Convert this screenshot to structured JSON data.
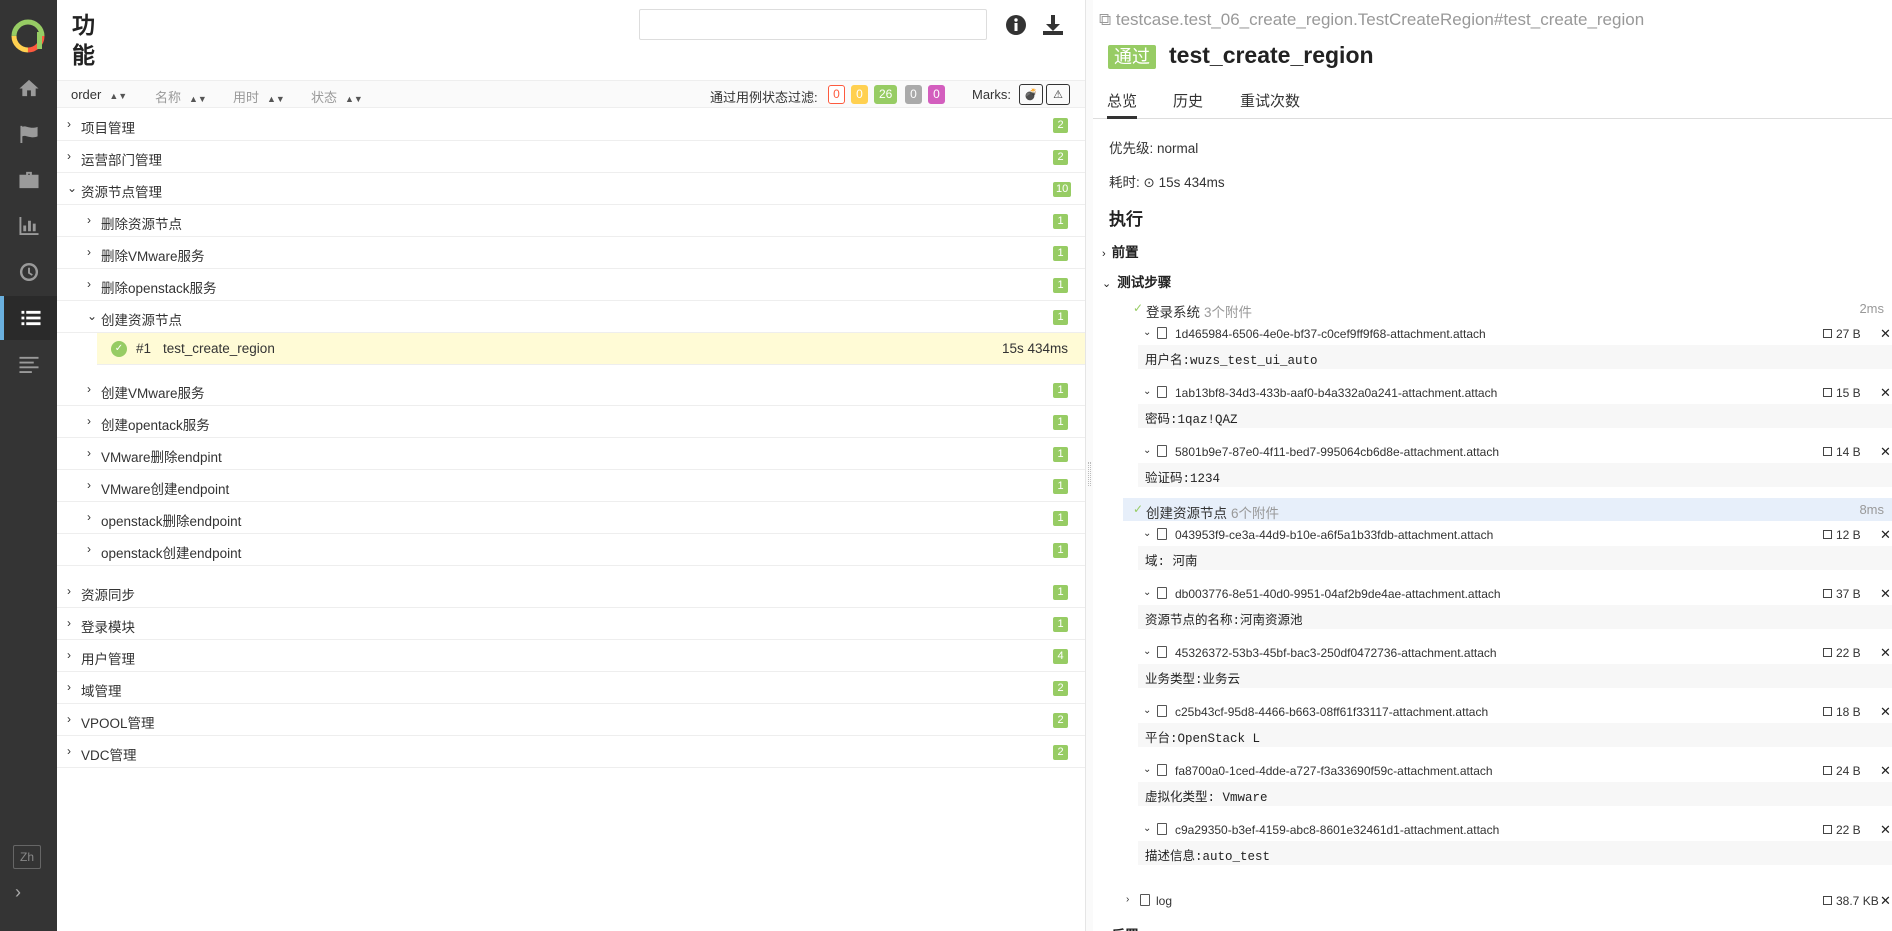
{
  "sidebar": {
    "logo": "allure-logo-icon",
    "nav": [
      "home-icon",
      "flag-icon",
      "briefcase-icon",
      "chart-icon",
      "clock-icon",
      "list-icon",
      "lines-icon"
    ],
    "active_index": 5,
    "lang": "Zh"
  },
  "left": {
    "title": "功能",
    "sort_columns": [
      "order",
      "名称",
      "用时",
      "状态"
    ],
    "filter_label": "通过用例状态过滤:",
    "filter_badges": [
      "0",
      "0",
      "26",
      "0",
      "0"
    ],
    "marks_label": "Marks:",
    "tree": [
      {
        "label": "项目管理",
        "count": "2",
        "level": 0,
        "open": false
      },
      {
        "label": "运营部门管理",
        "count": "2",
        "level": 0,
        "open": false
      },
      {
        "label": "资源节点管理",
        "count": "10",
        "level": 0,
        "open": true
      },
      {
        "label": "删除资源节点",
        "count": "1",
        "level": 1,
        "open": false
      },
      {
        "label": "删除VMware服务",
        "count": "1",
        "level": 1,
        "open": false
      },
      {
        "label": "删除openstack服务",
        "count": "1",
        "level": 1,
        "open": false
      },
      {
        "label": "创建资源节点",
        "count": "1",
        "level": 1,
        "open": true
      },
      {
        "label": "创建VMware服务",
        "count": "1",
        "level": 1,
        "open": false
      },
      {
        "label": "创建opentack服务",
        "count": "1",
        "level": 1,
        "open": false
      },
      {
        "label": "VMware删除endpint",
        "count": "1",
        "level": 1,
        "open": false
      },
      {
        "label": "VMware创建endpoint",
        "count": "1",
        "level": 1,
        "open": false
      },
      {
        "label": "openstack删除endpoint",
        "count": "1",
        "level": 1,
        "open": false
      },
      {
        "label": "openstack创建endpoint",
        "count": "1",
        "level": 1,
        "open": false
      },
      {
        "label": "资源同步",
        "count": "1",
        "level": 0,
        "open": false
      },
      {
        "label": "登录模块",
        "count": "1",
        "level": 0,
        "open": false
      },
      {
        "label": "用户管理",
        "count": "4",
        "level": 0,
        "open": false
      },
      {
        "label": "域管理",
        "count": "2",
        "level": 0,
        "open": false
      },
      {
        "label": "VPOOL管理",
        "count": "2",
        "level": 0,
        "open": false
      },
      {
        "label": "VDC管理",
        "count": "2",
        "level": 0,
        "open": false
      }
    ],
    "selected_case": {
      "num": "#1",
      "name": "test_create_region",
      "duration": "15s 434ms"
    }
  },
  "right": {
    "fullname": "testcase.test_06_create_region.TestCreateRegion#test_create_region",
    "status": "通过",
    "name": "test_create_region",
    "tabs": [
      "总览",
      "历史",
      "重试次数"
    ],
    "priority": "优先级: normal",
    "duration": "耗时: ⊙ 15s 434ms",
    "exec_title": "执行",
    "setup": "前置",
    "steps_title": "测试步骤",
    "teardown": "后置",
    "steps": [
      {
        "name": "登录系统",
        "attach_count": "3个附件",
        "time": "2ms",
        "attachments": [
          {
            "file": "1d465984-6506-4e0e-bf37-c0cef9ff9f68-attachment.attach",
            "size": "27 B",
            "content": "用户名:wuzs_test_ui_auto"
          },
          {
            "file": "1ab13bf8-34d3-433b-aaf0-b4a332a0a241-attachment.attach",
            "size": "15 B",
            "content": "密码:1qaz!QAZ"
          },
          {
            "file": "5801b9e7-87e0-4f11-bed7-995064cb6d8e-attachment.attach",
            "size": "14 B",
            "content": "验证码:1234"
          }
        ]
      },
      {
        "name": "创建资源节点",
        "attach_count": "6个附件",
        "time": "8ms",
        "attachments": [
          {
            "file": "043953f9-ce3a-44d9-b10e-a6f5a1b33fdb-attachment.attach",
            "size": "12 B",
            "content": "域: 河南"
          },
          {
            "file": "db003776-8e51-40d0-9951-04af2b9de4ae-attachment.attach",
            "size": "37 B",
            "content": "资源节点的名称:河南资源池"
          },
          {
            "file": "45326372-53b3-45bf-bac3-250df0472736-attachment.attach",
            "size": "22 B",
            "content": "业务类型:业务云"
          },
          {
            "file": "c25b43cf-95d8-4466-b663-08ff61f33117-attachment.attach",
            "size": "18 B",
            "content": "平台:OpenStack L"
          },
          {
            "file": "fa8700a0-1ced-4dde-a727-f3a33690f59c-attachment.attach",
            "size": "24 B",
            "content": "虚拟化类型: Vmware"
          },
          {
            "file": "c9a29350-b3ef-4159-abc8-8601e32461d1-attachment.attach",
            "size": "22 B",
            "content": "描述信息:auto_test"
          }
        ]
      }
    ],
    "log": {
      "name": "log",
      "size": "38.7 KB"
    }
  }
}
